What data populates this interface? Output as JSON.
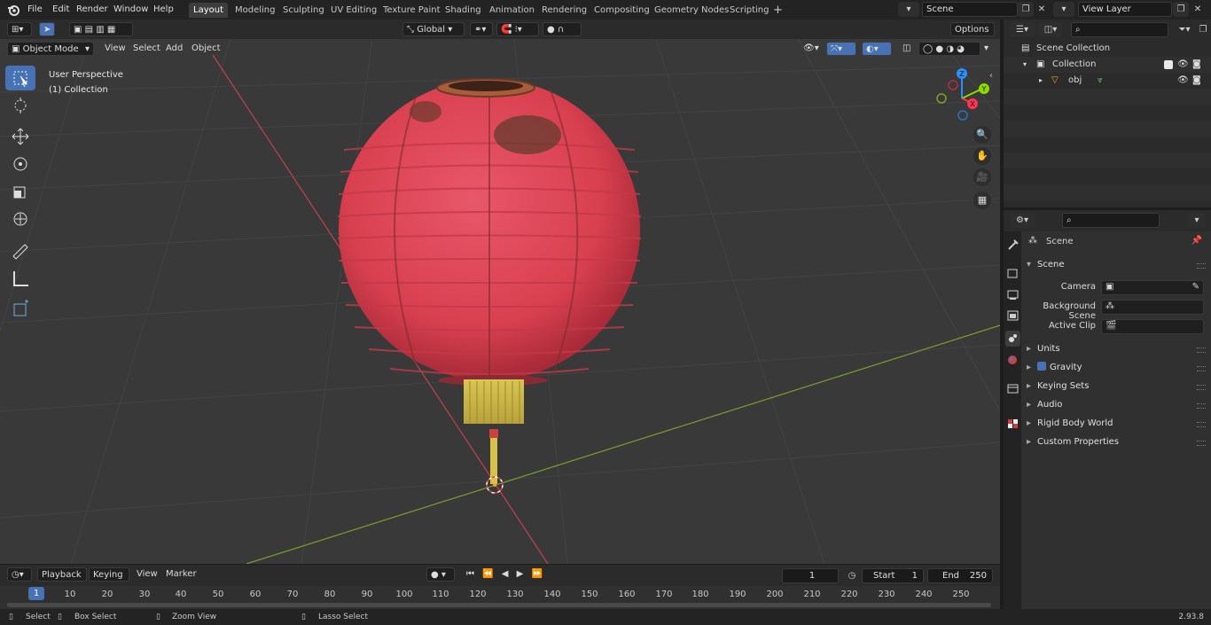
{
  "topbar": {
    "menus": [
      "File",
      "Edit",
      "Render",
      "Window",
      "Help"
    ],
    "workspaces": [
      "Layout",
      "Modeling",
      "Sculpting",
      "UV Editing",
      "Texture Paint",
      "Shading",
      "Animation",
      "Rendering",
      "Compositing",
      "Geometry Nodes",
      "Scripting"
    ],
    "active_workspace": "Layout",
    "scene_name": "Scene",
    "view_layer": "View Layer"
  },
  "viewport_header": {
    "mode": "Object Mode",
    "menus": [
      "View",
      "Select",
      "Add",
      "Object"
    ],
    "orientation": "Global",
    "options_label": "Options"
  },
  "viewport": {
    "perspective_label": "User Perspective",
    "collection_label": "(1) Collection",
    "gizmo_axes": {
      "x": "X",
      "y": "Y",
      "z": "Z"
    },
    "colors": {
      "x_axis": "#ff3352",
      "y_axis": "#8bdc00",
      "z_axis": "#2890ff",
      "lantern": "#d9404f",
      "tassel": "#d6c24a"
    }
  },
  "toolbar": {
    "tools": [
      "select-box",
      "cursor",
      "move",
      "rotate",
      "scale",
      "transform",
      "annotate",
      "measure",
      "add-cube"
    ]
  },
  "timeline": {
    "menus": [
      "Playback",
      "Keying",
      "View",
      "Marker"
    ],
    "current_frame": "1",
    "start_label": "Start",
    "start_value": "1",
    "end_label": "End",
    "end_value": "250",
    "ruler_current": "1",
    "ticks": [
      "10",
      "20",
      "30",
      "40",
      "50",
      "60",
      "70",
      "80",
      "90",
      "100",
      "110",
      "120",
      "130",
      "140",
      "150",
      "160",
      "170",
      "180",
      "190",
      "200",
      "210",
      "220",
      "230",
      "240",
      "250"
    ]
  },
  "statusbar": {
    "items": [
      "Select",
      "Box Select",
      "Zoom View",
      "Lasso Select"
    ],
    "version": "2.93.8"
  },
  "outliner": {
    "scene_collection": "Scene Collection",
    "collection": "Collection",
    "object": "obj"
  },
  "properties": {
    "context": "Scene",
    "panel_title": "Scene",
    "fields": [
      {
        "label": "Camera"
      },
      {
        "label": "Background Scene"
      },
      {
        "label": "Active Clip"
      }
    ],
    "subpanels": [
      "Units",
      "Gravity",
      "Keying Sets",
      "Audio",
      "Rigid Body World",
      "Custom Properties"
    ]
  }
}
